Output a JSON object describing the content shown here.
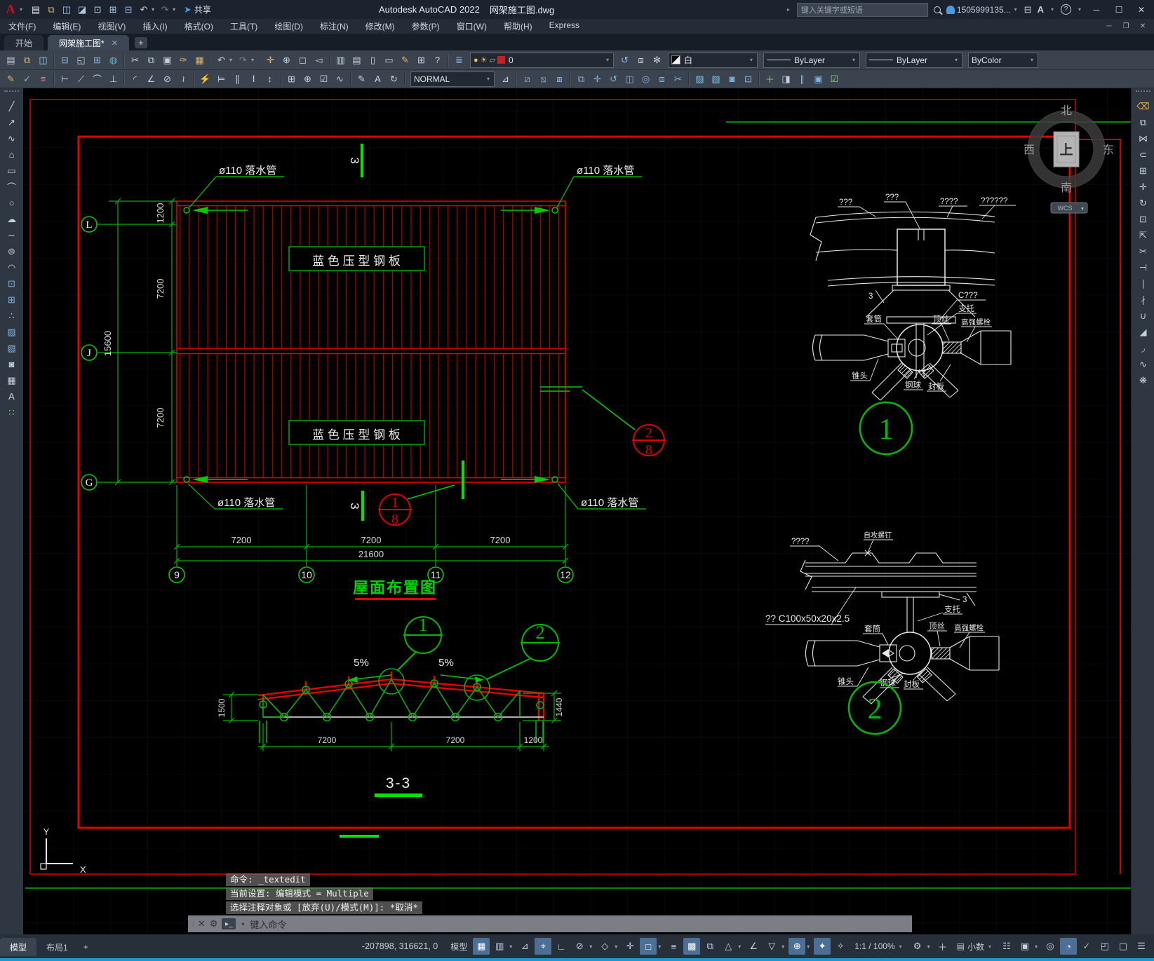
{
  "titlebar": {
    "share": "共享",
    "app_title": "Autodesk AutoCAD 2022",
    "doc_title": "网架施工图.dwg",
    "search_placeholder": "键入关键字或短语",
    "account": "1505999135...",
    "appstore": "A",
    "help_glyph": "?"
  },
  "menubar": {
    "items": [
      {
        "n": "file",
        "label": "文件(F)"
      },
      {
        "n": "edit",
        "label": "编辑(E)"
      },
      {
        "n": "view",
        "label": "视图(V)"
      },
      {
        "n": "insert",
        "label": "插入(I)"
      },
      {
        "n": "format",
        "label": "格式(O)"
      },
      {
        "n": "tools",
        "label": "工具(T)"
      },
      {
        "n": "draw",
        "label": "绘图(D)"
      },
      {
        "n": "dimension",
        "label": "标注(N)"
      },
      {
        "n": "modify",
        "label": "修改(M)"
      },
      {
        "n": "parametric",
        "label": "参数(P)"
      },
      {
        "n": "window",
        "label": "窗口(W)"
      },
      {
        "n": "help",
        "label": "帮助(H)"
      },
      {
        "n": "express",
        "label": "Express"
      }
    ]
  },
  "doctabs": {
    "start": "开始",
    "active": "网架施工图*"
  },
  "toolbars": {
    "quick": [
      {
        "n": "new",
        "g": "▤",
        "c": "#dde3ea"
      },
      {
        "n": "open",
        "g": "⧉",
        "c": "#d9b36a"
      },
      {
        "n": "save",
        "g": "◫",
        "c": "#a9cdec"
      },
      {
        "n": "save-as",
        "g": "◪",
        "c": "#a9cdec"
      },
      {
        "n": "export",
        "g": "⊡",
        "c": "#a9cdec"
      },
      {
        "n": "publish",
        "g": "⊞",
        "c": "#a9cdec"
      },
      {
        "n": "print",
        "g": "⊟",
        "c": "#8fb4d8"
      },
      {
        "n": "undo",
        "g": "↶",
        "c": "#c4cedb",
        "d": 1
      },
      {
        "n": "redo",
        "g": "↷",
        "c": "#6d7988",
        "d": 1
      }
    ],
    "row1": [
      {
        "n": "qnew",
        "g": "▤"
      },
      {
        "n": "open-file",
        "g": "⧉",
        "c": "#d9b36a"
      },
      {
        "n": "qsave",
        "g": "◫",
        "c": "#a9cdec"
      },
      {
        "s": 1
      },
      {
        "n": "print",
        "g": "⊟",
        "c": "#7fb3e0"
      },
      {
        "n": "plot-preview",
        "g": "◱"
      },
      {
        "n": "batch-plot",
        "g": "⊞",
        "c": "#7fb3e0"
      },
      {
        "n": "publish",
        "g": "◍",
        "c": "#6ab0d8"
      },
      {
        "s": 1
      },
      {
        "n": "cut",
        "g": "✂"
      },
      {
        "n": "copy-clip",
        "g": "⧉"
      },
      {
        "n": "paste",
        "g": "▣"
      },
      {
        "n": "match-properties",
        "g": "✑",
        "c": "#d9b36a"
      },
      {
        "n": "block-editor",
        "g": "▦",
        "c": "#d9b36a"
      },
      {
        "s": 1
      },
      {
        "n": "undo",
        "g": "↶",
        "d": 1
      },
      {
        "n": "redo",
        "g": "↷",
        "c": "#78828f",
        "d": 1
      },
      {
        "s": 1
      },
      {
        "n": "pan",
        "g": "✛",
        "c": "#e3c06a"
      },
      {
        "n": "zoom-realtime",
        "g": "⊕"
      },
      {
        "n": "zoom-window",
        "g": "◻"
      },
      {
        "n": "zoom-previous",
        "g": "◅"
      },
      {
        "s": 1
      },
      {
        "n": "properties-palette",
        "g": "▥"
      },
      {
        "n": "design-center",
        "g": "▤"
      },
      {
        "n": "tool-palettes",
        "g": "▯"
      },
      {
        "n": "sheet-set-manager",
        "g": "▭"
      },
      {
        "n": "markup",
        "g": "✎",
        "c": "#d9b36a"
      },
      {
        "n": "quick-calc",
        "g": "⊞"
      },
      {
        "n": "help",
        "g": "?"
      },
      {
        "s": 1
      },
      {
        "n": "layer-properties",
        "g": "≣",
        "c": "#89b8e6"
      }
    ],
    "layer_value": "0",
    "row1b": [
      {
        "n": "layer-previous",
        "g": "↺",
        "c": "#89b8e6"
      },
      {
        "n": "layer-isolate",
        "g": "⧈"
      },
      {
        "n": "layer-unisolate",
        "g": "✻"
      }
    ],
    "color_value": "白",
    "linetype_value": "ByLayer",
    "lineweight_value": "ByLayer",
    "plotstyle_value": "ByColor",
    "row2a": [
      {
        "n": "text-edit",
        "g": "✎",
        "c": "#d9b36a"
      },
      {
        "n": "spell-check",
        "g": "✓",
        "c": "#7fc87f"
      },
      {
        "n": "text-style",
        "g": "≡",
        "c": "#e08585"
      },
      {
        "s": 1
      },
      {
        "n": "dim-linear",
        "g": "⊢"
      },
      {
        "n": "dim-aligned",
        "g": "⟋"
      },
      {
        "n": "dim-arc-length",
        "g": "⌒"
      },
      {
        "n": "dim-ordinate",
        "g": "⊥"
      },
      {
        "s": 1
      },
      {
        "n": "dim-radius",
        "g": "◜"
      },
      {
        "n": "dim-angular",
        "g": "∠"
      },
      {
        "n": "dim-diameter",
        "g": "⊘"
      },
      {
        "n": "dim-jogged",
        "g": "≀"
      },
      {
        "s": 1
      },
      {
        "n": "qdim",
        "g": "⚡"
      },
      {
        "n": "dim-baseline",
        "g": "⊨"
      },
      {
        "n": "dim-continue",
        "g": "∥"
      },
      {
        "n": "dim-spacing",
        "g": "Ⅰ"
      },
      {
        "n": "dim-break",
        "g": "↕"
      },
      {
        "s": 1
      },
      {
        "n": "tolerance",
        "g": "⊞"
      },
      {
        "n": "center-mark",
        "g": "⊕"
      },
      {
        "n": "dim-inspect",
        "g": "☑"
      },
      {
        "n": "dim-jog-line",
        "g": "∿"
      },
      {
        "s": 1
      },
      {
        "n": "dim-edit",
        "g": "✎"
      },
      {
        "n": "dim-text-edit",
        "g": "A"
      },
      {
        "n": "dim-update",
        "g": "↻"
      },
      {
        "s": 1
      }
    ],
    "style_value": "NORMAL",
    "row2b": [
      {
        "n": "dim-style-manager",
        "g": "⊿"
      },
      {
        "s": 1
      },
      {
        "n": "draworder-front",
        "g": "⧄",
        "c": "#7fb3e0"
      },
      {
        "n": "draworder-back",
        "g": "⧅",
        "c": "#7fb3e0"
      },
      {
        "n": "draworder-above",
        "g": "⧆",
        "c": "#7fb3e0"
      },
      {
        "s": 1
      },
      {
        "n": "copy",
        "g": "⧉",
        "c": "#7fb3e0"
      },
      {
        "n": "move",
        "g": "✛",
        "c": "#7fb3e0"
      },
      {
        "n": "rotate",
        "g": "↺",
        "c": "#7fb3e0"
      },
      {
        "n": "mirror",
        "g": "◫",
        "c": "#7fb3e0"
      },
      {
        "n": "offset",
        "g": "◎",
        "c": "#7fb3e0"
      },
      {
        "n": "scale",
        "g": "⧈",
        "c": "#7fb3e0"
      },
      {
        "n": "trim",
        "g": "✂",
        "c": "#7fb3e0"
      },
      {
        "s": 1
      },
      {
        "n": "hatch-edit",
        "g": "▨",
        "c": "#79c2e8"
      },
      {
        "n": "gradient-edit",
        "g": "▧",
        "c": "#79c2e8"
      },
      {
        "n": "boundary",
        "g": "◙",
        "c": "#79c2e8"
      },
      {
        "n": "region",
        "g": "⊡",
        "c": "#79c2e8"
      },
      {
        "s": 1
      },
      {
        "n": "add-selected",
        "g": "＋",
        "c": "#7fd87f"
      },
      {
        "n": "isolate-objects",
        "g": "◨"
      },
      {
        "n": "align",
        "g": "∥",
        "c": "#7fb3e0"
      },
      {
        "n": "group",
        "g": "▣",
        "c": "#7fb3e0"
      },
      {
        "n": "group-edit",
        "g": "☑",
        "c": "#7fd87f"
      }
    ]
  },
  "left_toolbar": [
    {
      "n": "line",
      "g": "╱"
    },
    {
      "n": "ray",
      "g": "↗"
    },
    {
      "n": "polyline",
      "g": "∿"
    },
    {
      "n": "polygon",
      "g": "⌂"
    },
    {
      "n": "rectangle",
      "g": "▭"
    },
    {
      "n": "arc",
      "g": "⌒"
    },
    {
      "n": "circle",
      "g": "○"
    },
    {
      "n": "revision-cloud",
      "g": "☁"
    },
    {
      "n": "spline",
      "g": "∼"
    },
    {
      "n": "ellipse",
      "g": "⊜"
    },
    {
      "n": "ellipse-arc",
      "g": "◠"
    },
    {
      "n": "insert-block",
      "g": "⊡",
      "c": "#7fb3e0"
    },
    {
      "n": "create-block",
      "g": "⊞",
      "c": "#7fb3e0"
    },
    {
      "n": "point",
      "g": "∴"
    },
    {
      "n": "hatch",
      "g": "▨",
      "c": "#7fb3e0"
    },
    {
      "n": "gradient",
      "g": "▧",
      "c": "#7fb3e0"
    },
    {
      "n": "region",
      "g": "◙"
    },
    {
      "n": "table",
      "g": "▦"
    },
    {
      "n": "mtext",
      "g": "A"
    },
    {
      "n": "point-style",
      "g": "∷",
      "c": "#7fd87f"
    }
  ],
  "right_toolbar": [
    {
      "n": "erase",
      "g": "⌫",
      "c": "#e8b04a"
    },
    {
      "n": "copy",
      "g": "⧉"
    },
    {
      "n": "mirror",
      "g": "⋈"
    },
    {
      "n": "offset",
      "g": "⊂"
    },
    {
      "n": "array",
      "g": "⊞"
    },
    {
      "n": "move",
      "g": "✛"
    },
    {
      "n": "rotate",
      "g": "↻"
    },
    {
      "n": "scale",
      "g": "⊡"
    },
    {
      "n": "stretch",
      "g": "⇱"
    },
    {
      "n": "trim",
      "g": "✂"
    },
    {
      "n": "extend",
      "g": "⊣"
    },
    {
      "n": "break-at-point",
      "g": "∣"
    },
    {
      "n": "break",
      "g": "∤"
    },
    {
      "n": "join",
      "g": "∪"
    },
    {
      "n": "chamfer",
      "g": "◢"
    },
    {
      "n": "fillet",
      "g": "◞"
    },
    {
      "n": "blend-curves",
      "g": "∿"
    },
    {
      "n": "explode",
      "g": "❋"
    }
  ],
  "drawing": {
    "labels": {
      "downspout": "ø110 落水管",
      "panel": "蓝 色 压 型 钢 板",
      "plan_title": "屋面布置图",
      "section_mark": "3",
      "section_title": "3-3",
      "slope": "5%"
    },
    "dims": {
      "d1200": "1200",
      "d7200": "7200",
      "d15600": "15600",
      "d21600": "21600",
      "d1500": "1500",
      "d1440": "1440"
    },
    "bubbles": {
      "L": "L",
      "J": "J",
      "G": "G",
      "b9": "9",
      "b10": "10",
      "b11": "11",
      "b12": "12",
      "n1": "1",
      "n2": "2",
      "n8": "8"
    },
    "shared": {
      "zhituo": "支托",
      "taotong": "套筒",
      "dingsi": "顶丝",
      "gaoqiang": "高强螺栓",
      "zhuitou": "锥头",
      "gangqiu": "钢球",
      "fengban": "封板"
    },
    "detail1": {
      "q3a": "???",
      "q3b": "???",
      "q4": "????",
      "q6": "??????",
      "c": "C???",
      "mark": "3"
    },
    "detail2": {
      "q4": "????",
      "zigong": "自攻螺钉",
      "purlin": "?? C100x50x20x2.5",
      "mark": "3"
    },
    "viewcube": {
      "n": "北",
      "s": "南",
      "w": "西",
      "e": "东",
      "top": "上",
      "wcs": "WCS"
    },
    "ucs": {
      "x": "X",
      "y": "Y"
    },
    "command": {
      "l1": "命令: _textedit",
      "l2": "当前设置: 编辑模式 = Multiple",
      "l3": "选择注释对象或 [放弃(U)/模式(M)]: *取消*",
      "placeholder": "键入命令"
    }
  },
  "statusbar": {
    "model_tab": "模型",
    "layout_tab": "布局1",
    "plus": "+",
    "coords": "-207898, 316621, 0",
    "model_btn": "模型",
    "scale": "1:1 / 100%",
    "units": "小数",
    "icons1": [
      {
        "n": "grid-display",
        "g": "▦",
        "a": 1
      },
      {
        "n": "snap-mode",
        "g": "▥",
        "d": 1
      },
      {
        "n": "infer-constraints",
        "g": "⊿"
      },
      {
        "n": "dynamic-input",
        "g": "⌖",
        "a": 1
      },
      {
        "n": "ortho-mode",
        "g": "∟"
      },
      {
        "n": "polar-tracking",
        "g": "⊘",
        "d": 1
      },
      {
        "n": "isodraft",
        "g": "◇",
        "d": 1
      },
      {
        "n": "osnap-tracking",
        "g": "✛"
      },
      {
        "n": "object-snap",
        "g": "□",
        "a": 1,
        "d": 1
      },
      {
        "n": "lineweight-display",
        "g": "≡"
      },
      {
        "n": "transparency",
        "g": "▩",
        "a": 1
      },
      {
        "n": "selection-cycling",
        "g": "⧉"
      },
      {
        "n": "osnap-3d",
        "g": "△",
        "d": 1
      },
      {
        "n": "dynamic-ucs",
        "g": "∠"
      },
      {
        "n": "selection-filtering",
        "g": "▽",
        "d": 1
      },
      {
        "n": "gizmo",
        "g": "⊕",
        "a": 1,
        "d": 1
      },
      {
        "n": "annotation-visibility",
        "g": "✦",
        "a": 1
      },
      {
        "n": "annotation-autoscale",
        "g": "✧"
      }
    ],
    "icons2": [
      {
        "n": "workspace-switching",
        "g": "⚙",
        "d": 1
      },
      {
        "n": "annotation-monitor",
        "g": "＋"
      }
    ],
    "icons3": [
      {
        "n": "quick-properties",
        "g": "☷"
      },
      {
        "n": "lock-ui",
        "g": "▣",
        "d": 1
      },
      {
        "n": "isolate-objects",
        "g": "◎"
      },
      {
        "n": "graphics-performance",
        "g": "◔",
        "a": 1
      },
      {
        "n": "trusted-autoloader",
        "g": "✓",
        "c": "#7fd87f"
      },
      {
        "n": "clean-screen",
        "g": "◰"
      },
      {
        "n": "fullscreen",
        "g": "▢"
      },
      {
        "n": "customization",
        "g": "☰"
      }
    ]
  }
}
